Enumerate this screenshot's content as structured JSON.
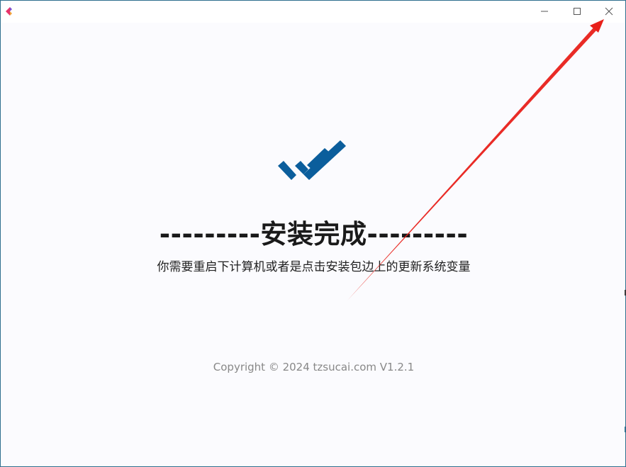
{
  "window": {
    "app_icon": "app-logo-icon",
    "controls": {
      "minimize_icon": "minimize-icon",
      "maximize_icon": "maximize-icon",
      "close_icon": "close-icon"
    }
  },
  "main": {
    "logo_icon": "double-check-icon",
    "heading": "---------安装完成---------",
    "subtitle": "你需要重启下计算机或者是点击安装包边上的更新系统变量",
    "copyright": "Copyright © 2024 tzsucai.com V1.2.1"
  },
  "colors": {
    "accent": "#0b5e9c",
    "annotation": "#e8201a",
    "window_border": "#2f6f8f",
    "background": "#fbfbfe"
  }
}
